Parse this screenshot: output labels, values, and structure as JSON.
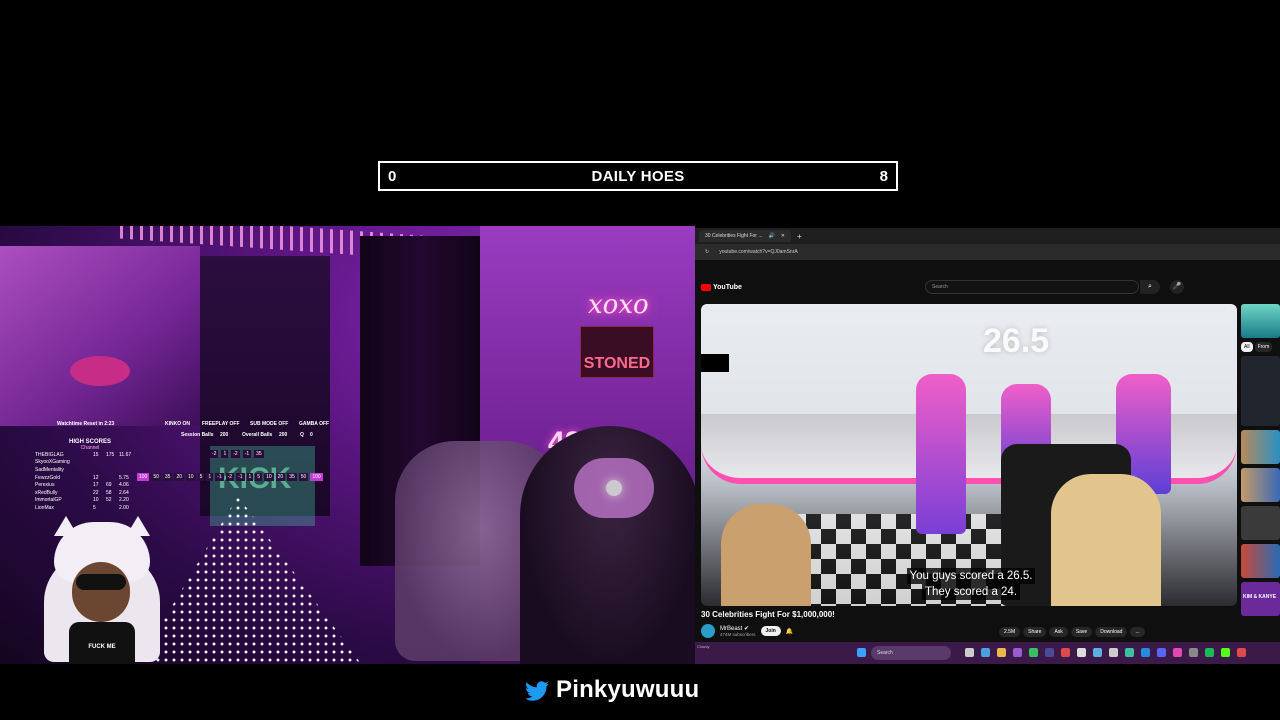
{
  "counter": {
    "left": "0",
    "title": "DAILY HOES",
    "right": "8"
  },
  "webcam": {
    "neon_sign": "xoxo",
    "stoned_sign": "STONED",
    "neon_number": "42",
    "shelf_sign": "KICK",
    "overlay": {
      "watchtime": "Watchtime Reset in 2:23",
      "kinko": "KINKO ON",
      "freeplay": "FREEPLAY OFF",
      "sub_mode": "SUB MODE OFF",
      "gamba": "GAMBA OFF",
      "session_balls_label": "Session Balls",
      "session_balls": "200",
      "overall_balls_label": "Overall Balls",
      "overall_balls": "200",
      "q_label": "Q",
      "q_value": "0",
      "high_scores_title": "HIGH SCORES",
      "high_scores_subtitle": "Channel",
      "high_scores": [
        [
          "THEBIGLAG",
          "15",
          "175",
          "11.67"
        ],
        [
          "SkyooXGaming",
          "",
          "",
          ""
        ],
        [
          "SadMentality",
          "",
          "",
          ""
        ],
        [
          "FewzzGold",
          "12",
          "",
          "5.75"
        ],
        [
          "Perexius",
          "17",
          "69",
          "4.06"
        ],
        [
          "xRedBully",
          "22",
          "58",
          "2.64"
        ],
        [
          "ImmortalGP",
          "10",
          "52",
          "2.20"
        ],
        [
          "LionMax",
          "5",
          "",
          "2.00"
        ]
      ],
      "tick_values": [
        "-2",
        "1",
        "-2",
        "-1",
        "35"
      ],
      "scale_values": [
        "100",
        "50",
        "35",
        "20",
        "10",
        "5",
        "1",
        "-1",
        "-2",
        "-1",
        "1",
        "5",
        "10",
        "20",
        "35",
        "50",
        "100"
      ]
    },
    "avatar_shirt": "FUCK ME"
  },
  "browser": {
    "tab_title": "30 Celebrities Fight For ...",
    "url": "youtube.com/watch?v=QJ0amSnrA",
    "logo": "YouTube",
    "search_placeholder": "Search",
    "video": {
      "score_overlay": "26.5",
      "caption_line1": "You guys scored a 26.5.",
      "caption_line2": "They scored a 24."
    },
    "video_title": "30 Celebrities Fight For $1,000,000!",
    "channel": "MrBeast",
    "subscribers": "474M subscribers",
    "join": "Join",
    "actions": [
      "2.5M",
      "Share",
      "Ask",
      "Save",
      "Download",
      "..."
    ],
    "chips": [
      "All",
      "From"
    ],
    "side_label": "KIM & KANYE",
    "taskbar_search": "Search",
    "taskbar_weather": "Cloudy"
  },
  "footer": {
    "handle": "Pinkyuwuuu"
  },
  "colors": {
    "neon_pink": "#ff4fc8",
    "purple": "#5a1580",
    "twitter": "#1d9bf0",
    "yt_red": "#ff0000"
  }
}
